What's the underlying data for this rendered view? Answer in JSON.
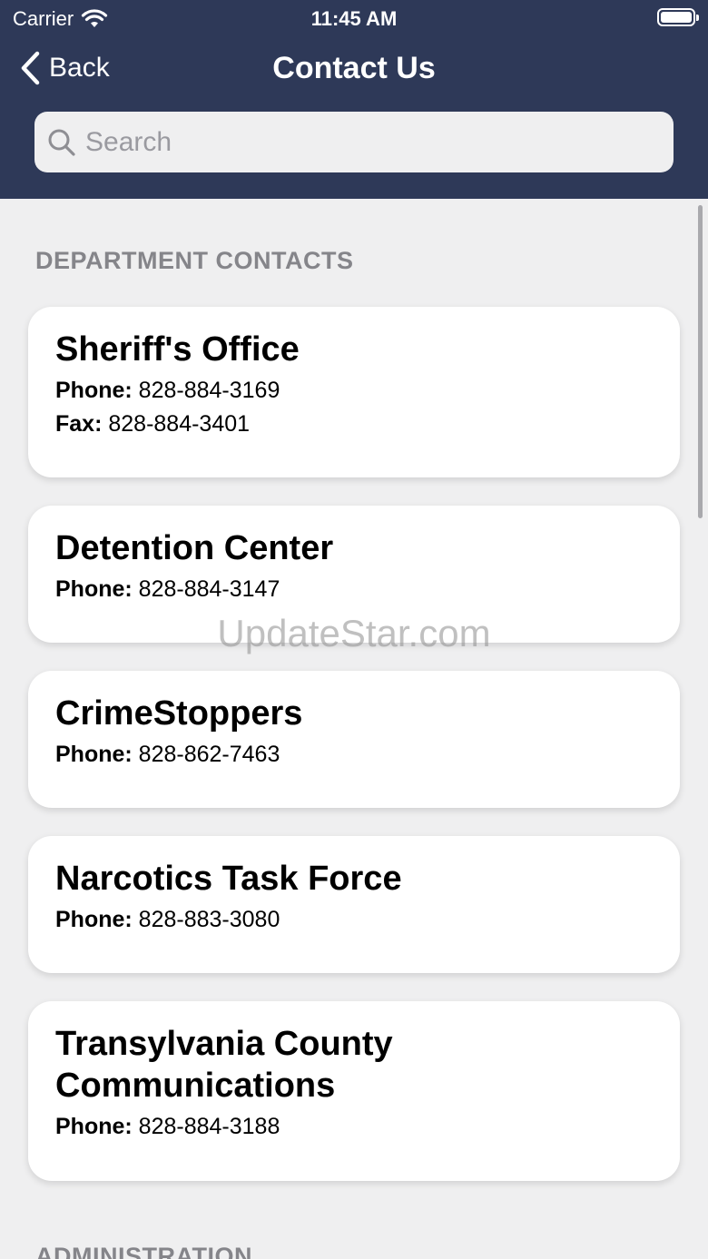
{
  "status_bar": {
    "carrier": "Carrier",
    "time": "11:45 AM"
  },
  "nav": {
    "back_label": "Back",
    "title": "Contact Us"
  },
  "search": {
    "placeholder": "Search"
  },
  "sections": [
    {
      "title": "DEPARTMENT CONTACTS"
    },
    {
      "title": "ADMINISTRATION"
    }
  ],
  "contacts": [
    {
      "name": "Sheriff's Office",
      "phone_label": "Phone:",
      "phone": "828-884-3169",
      "fax_label": "Fax:",
      "fax": "828-884-3401"
    },
    {
      "name": "Detention Center",
      "phone_label": "Phone:",
      "phone": "828-884-3147"
    },
    {
      "name": "CrimeStoppers",
      "phone_label": "Phone:",
      "phone": "828-862-7463"
    },
    {
      "name": "Narcotics Task Force",
      "phone_label": "Phone:",
      "phone": "828-883-3080"
    },
    {
      "name": "Transylvania County Communications",
      "phone_label": "Phone:",
      "phone": "828-884-3188"
    }
  ],
  "watermark": "UpdateStar.com",
  "colors": {
    "header": "#2e3958",
    "background": "#efeff0",
    "card": "#ffffff",
    "section_text": "#85858a"
  }
}
